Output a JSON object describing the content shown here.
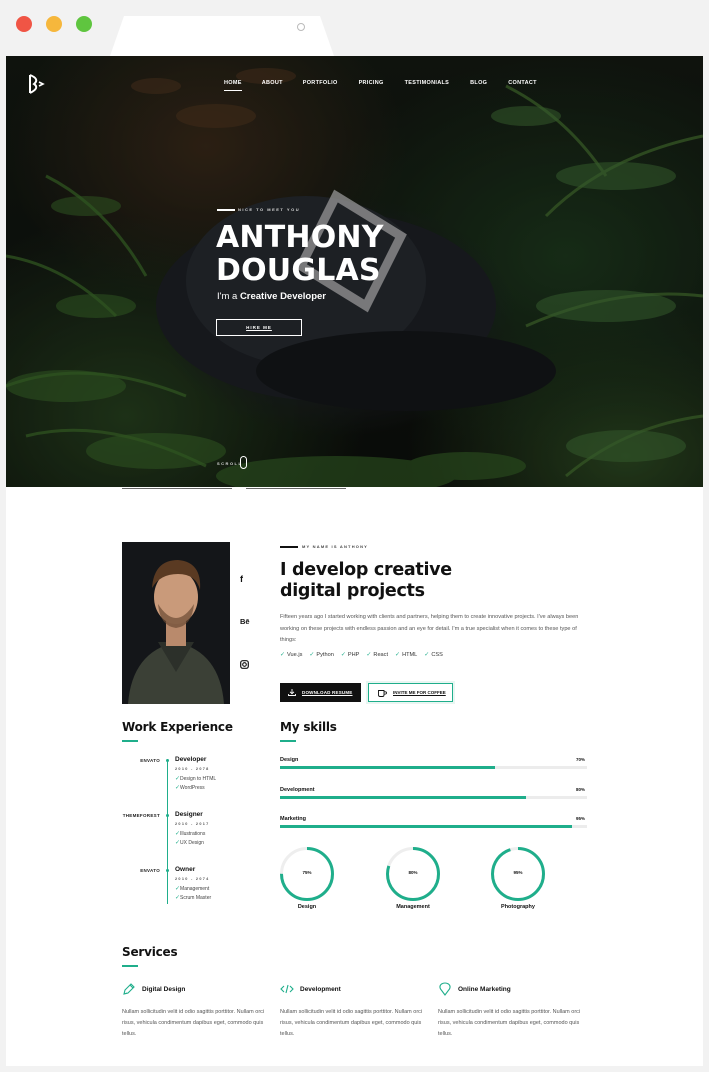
{
  "colors": {
    "accent": "#1fae8b",
    "dark": "#111111",
    "hero_bg": "#141a12"
  },
  "nav": {
    "items": [
      {
        "label": "HOME",
        "active": true
      },
      {
        "label": "ABOUT"
      },
      {
        "label": "PORTFOLIO"
      },
      {
        "label": "PRICING"
      },
      {
        "label": "TESTIMONIALS"
      },
      {
        "label": "BLOG"
      },
      {
        "label": "CONTACT"
      }
    ]
  },
  "hero": {
    "kicker": "NICE TO MEET YOU",
    "name_line1": "ANTHONY",
    "name_line2": "DOUGLAS",
    "sub_prefix": "I'm a ",
    "sub_bold": "Creative Developer",
    "hire_label": "HIRE ME",
    "scroll_label": "SCROLL"
  },
  "about": {
    "kicker": "MY NAME IS ANTHONY",
    "title_line1": "I develop creative",
    "title_line2": "digital projects",
    "text": "Fifteen years ago I started working with clients and partners, helping them to create innovative projects. I've always been working on these projects with endless passion and an eye for detail. I'm a true specialist when it comes to these type of things:",
    "tech": [
      "Vue.js",
      "Python",
      "PHP",
      "React",
      "HTML",
      "CSS"
    ],
    "download_label": "DOWNLOAD RESUME",
    "coffee_label": "INVITE ME FOR COFFEE",
    "social": [
      {
        "icon": "facebook-icon",
        "glyph": "f"
      },
      {
        "icon": "behance-icon",
        "glyph": "Bē"
      },
      {
        "icon": "instagram-icon",
        "glyph": ""
      }
    ]
  },
  "experience": {
    "title": "Work Experience",
    "jobs": [
      {
        "company": "ENVATO",
        "role": "Developer",
        "years": "2010 - 2078",
        "items": [
          "Design to HTML",
          "WordPress"
        ]
      },
      {
        "company": "THEMEFOREST",
        "role": "Designer",
        "years": "2010 - 2017",
        "items": [
          "Illustrations",
          "UX Design"
        ]
      },
      {
        "company": "ENVATO",
        "role": "Owner",
        "years": "2010 - 2074",
        "items": [
          "Management",
          "Scrum Master"
        ]
      }
    ]
  },
  "skills": {
    "title": "My skills",
    "bars": [
      {
        "label": "Design",
        "value": 70,
        "display": "70%"
      },
      {
        "label": "Development",
        "value": 80,
        "display": "80%"
      },
      {
        "label": "Marketing",
        "value": 95,
        "display": "95%"
      }
    ],
    "circles": [
      {
        "label": "Design",
        "value": 75,
        "display": "75%"
      },
      {
        "label": "Management",
        "value": 80,
        "display": "80%"
      },
      {
        "label": "Photography",
        "value": 95,
        "display": "95%"
      }
    ]
  },
  "services": {
    "title": "Services",
    "items": [
      {
        "icon": "pen-icon",
        "title": "Digital Design",
        "text": "Nullam sollicitudin velit id odio sagittis porttitor. Nullam orci risus, vehicula condimentum dapibus eget, commodo quis tellus."
      },
      {
        "icon": "code-icon",
        "title": "Development",
        "text": "Nullam sollicitudin velit id odio sagittis porttitor. Nullam orci risus, vehicula condimentum dapibus eget, commodo quis tellus."
      },
      {
        "icon": "marker-icon",
        "title": "Online Marketing",
        "text": "Nullam sollicitudin velit id odio sagittis porttitor. Nullam orci risus, vehicula condimentum dapibus eget, commodo quis tellus."
      }
    ]
  }
}
